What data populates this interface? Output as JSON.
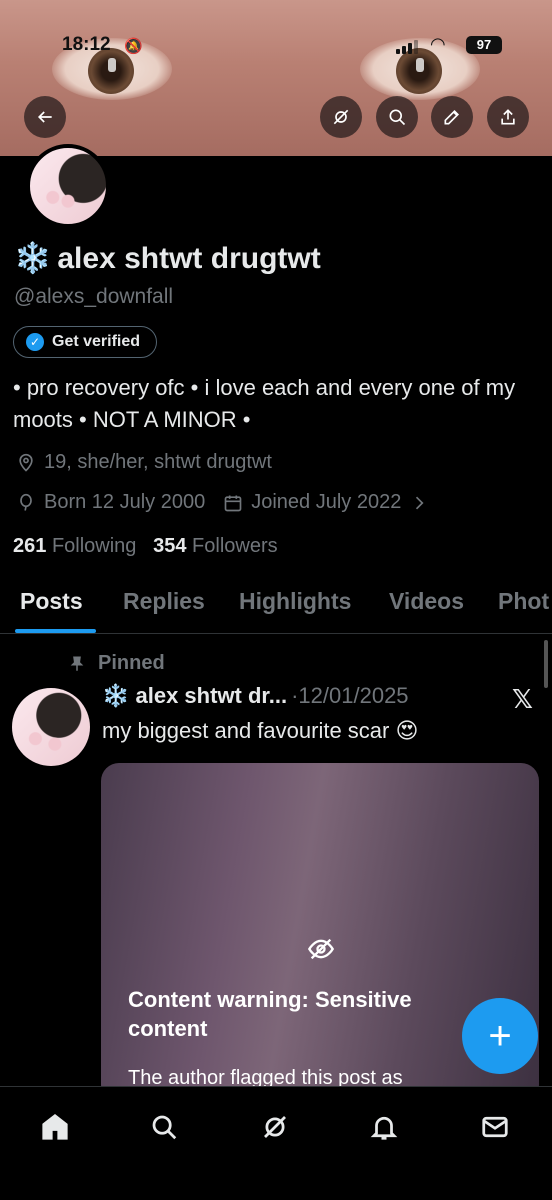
{
  "status_bar": {
    "time": "18:12",
    "battery": "97"
  },
  "profile": {
    "display_name": "alex shtwt drugtwt",
    "name_emoji": "❄️",
    "handle": "@alexs_downfall",
    "verify_label": "Get verified",
    "bio": "• pro recovery ofc • i love each and every one of my moots • NOT A MINOR •",
    "location": "19, she/her, shtwt drugtwt",
    "born": "Born 12 July 2000",
    "joined": "Joined July 2022",
    "following_count": "261",
    "following_label": "Following",
    "followers_count": "354",
    "followers_label": "Followers"
  },
  "tabs": [
    "Posts",
    "Replies",
    "Highlights",
    "Videos",
    "Phot"
  ],
  "post": {
    "pinned_label": "Pinned",
    "author": "❄️ alex shtwt dr...",
    "date": "·12/01/2025",
    "text": "my biggest and favourite scar 😍",
    "cw_title": "Content warning: Sensitive content",
    "cw_sub": "The author flagged this post as"
  },
  "colors": {
    "accent": "#1d9bf0",
    "text": "#e7e9ea",
    "muted": "#71767b",
    "bg": "#000000"
  },
  "icons": [
    "back-arrow-icon",
    "grok-icon",
    "search-icon",
    "edit-icon",
    "share-icon",
    "home-icon",
    "bell-icon",
    "mail-icon",
    "pin-icon",
    "location-icon",
    "balloon-icon",
    "calendar-icon",
    "eye-off-icon",
    "x-logo-icon",
    "plus-icon"
  ]
}
